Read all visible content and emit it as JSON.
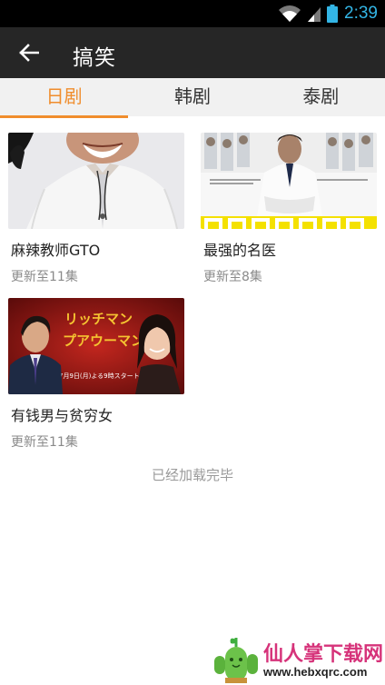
{
  "status_bar": {
    "time": "2:39"
  },
  "header": {
    "title": "搞笑"
  },
  "tabs": [
    {
      "label": "日剧",
      "active": true
    },
    {
      "label": "韩剧",
      "active": false
    },
    {
      "label": "泰剧",
      "active": false
    }
  ],
  "shows": [
    {
      "title": "麻辣教师GTO",
      "subtitle": "更新至11集"
    },
    {
      "title": "最强的名医",
      "subtitle": "更新至8集"
    },
    {
      "title": "有钱男与贫穷女",
      "subtitle": "更新至11集"
    }
  ],
  "poster_text": {
    "show3_title": "リッチマン",
    "show3_title2": "プアウーマン",
    "show3_airdate": "7月9日(月)よる9時スタート"
  },
  "footer": {
    "loaded_text": "已经加载完毕"
  },
  "watermark": {
    "brand": "仙人掌下载网",
    "url": "www.hebxqrc.com"
  },
  "colors": {
    "accent": "#f08d2c",
    "app_bar": "#262626",
    "status_icon": "#33b5e5"
  }
}
